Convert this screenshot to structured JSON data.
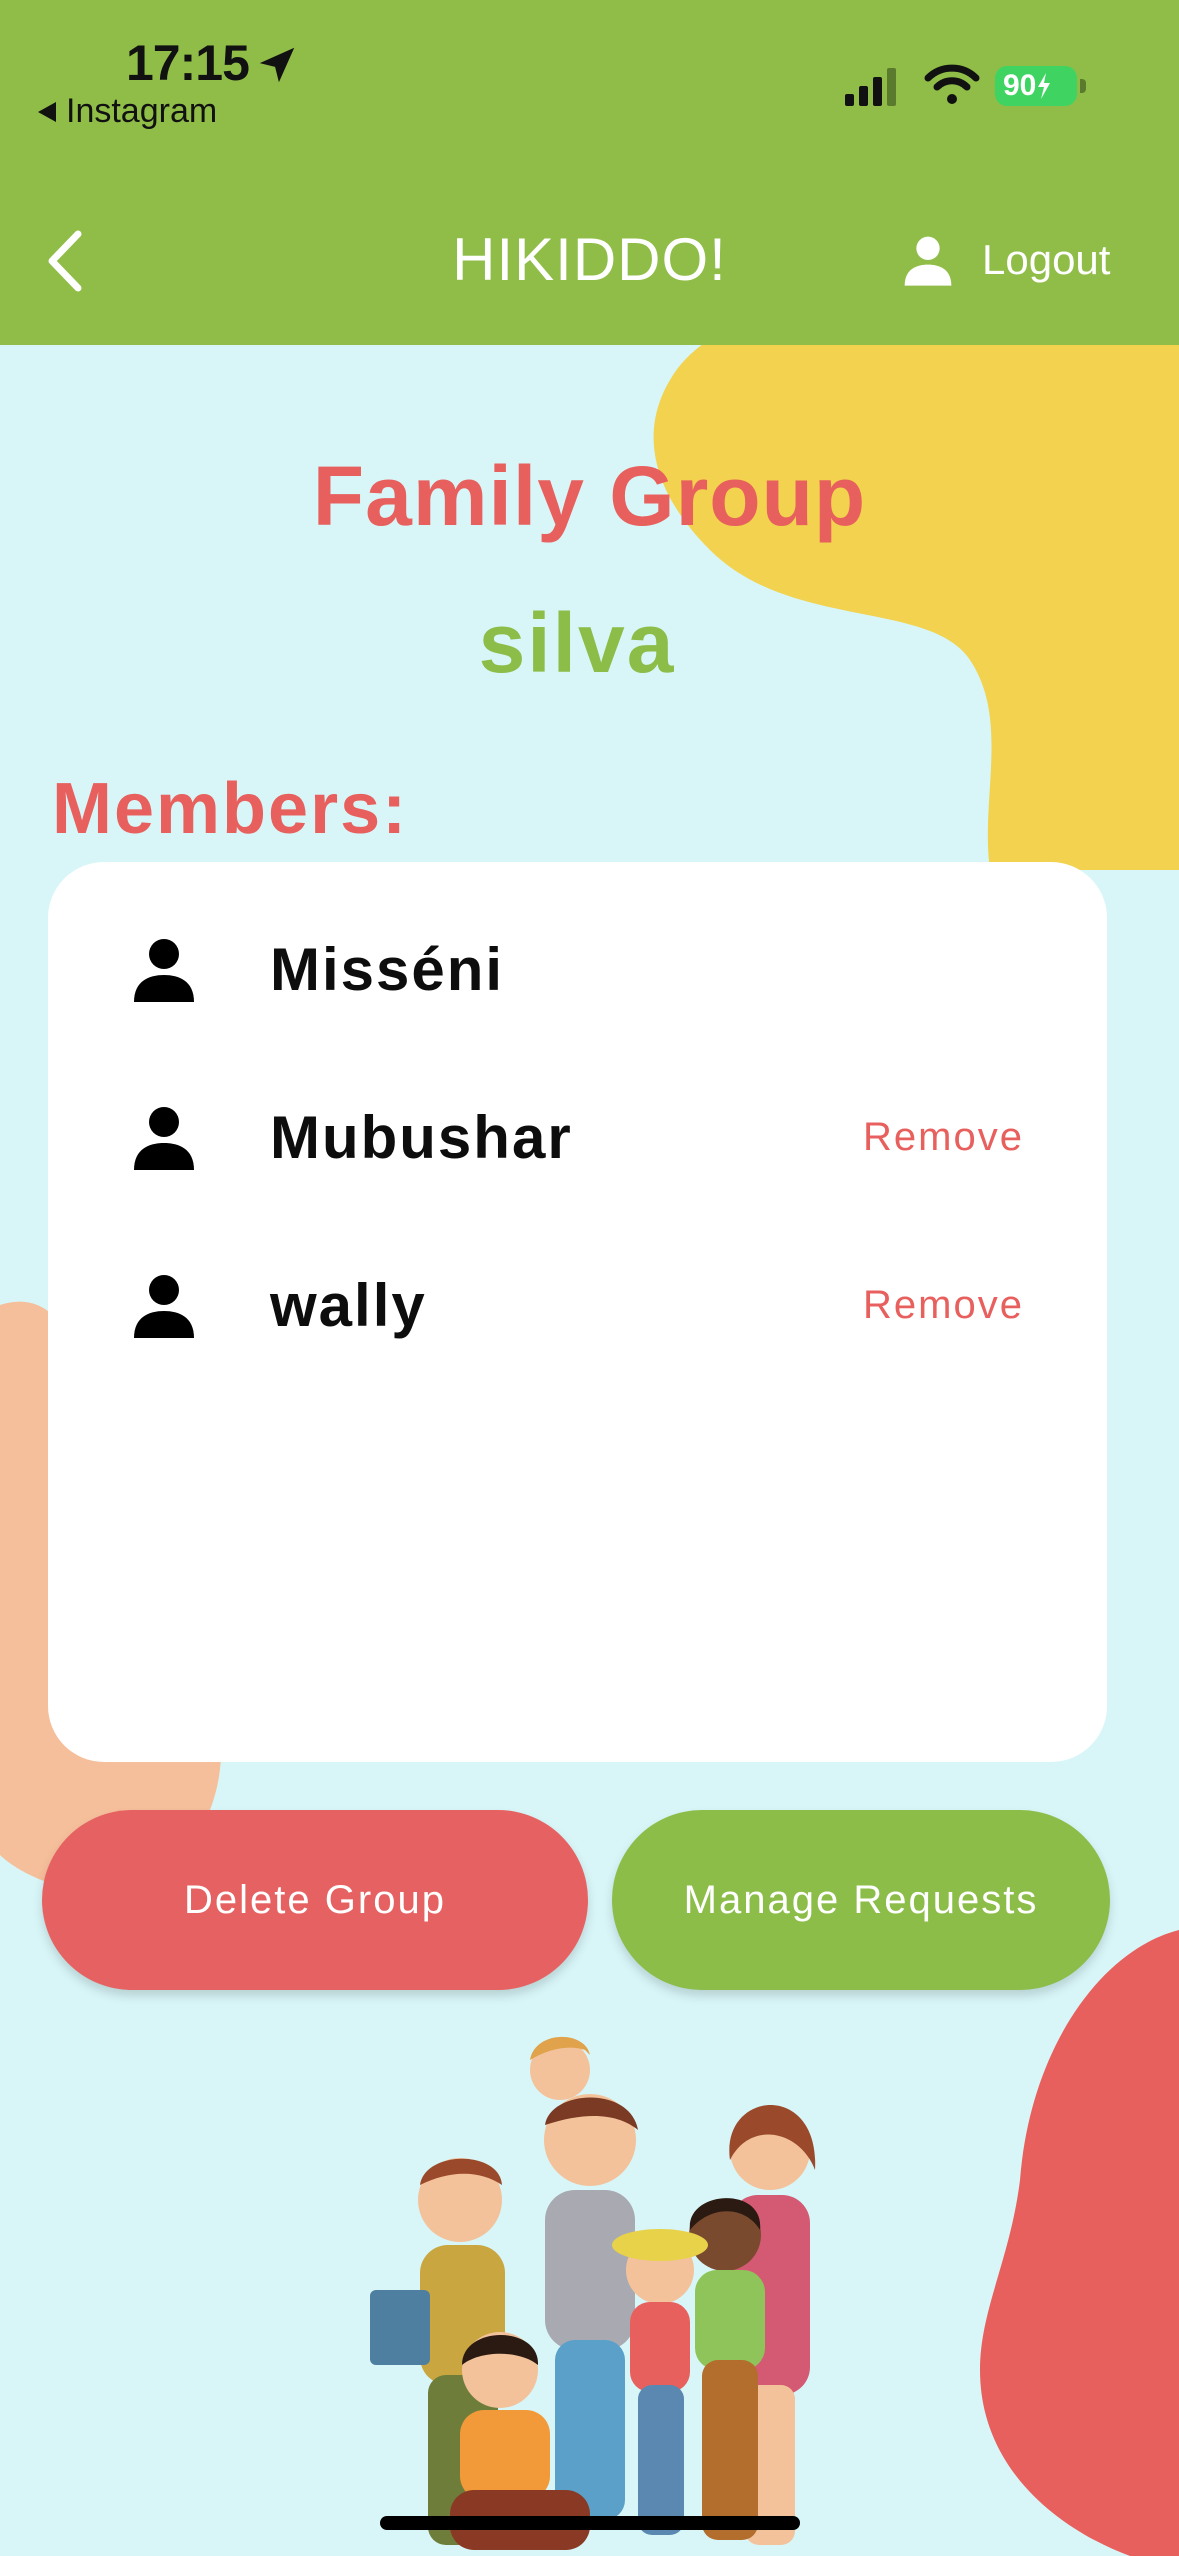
{
  "status_bar": {
    "time": "17:15",
    "back_app": "Instagram",
    "battery": "90"
  },
  "nav": {
    "title": "HIKIDDO!",
    "logout_label": "Logout"
  },
  "group": {
    "heading": "Family Group",
    "name": "silva",
    "members_label": "Members:"
  },
  "members": [
    {
      "name": "Misséni",
      "action": ""
    },
    {
      "name": "Mubushar",
      "action": "Remove"
    },
    {
      "name": "wally",
      "action": "Remove"
    }
  ],
  "actions": {
    "delete_label": "Delete Group",
    "manage_label": "Manage Requests"
  },
  "colors": {
    "header_green": "#8fbd48",
    "background": "#d8f6f8",
    "accent_red": "#e8605d",
    "blob_yellow": "#f2d24e",
    "blob_peach": "#f6bf9b"
  }
}
